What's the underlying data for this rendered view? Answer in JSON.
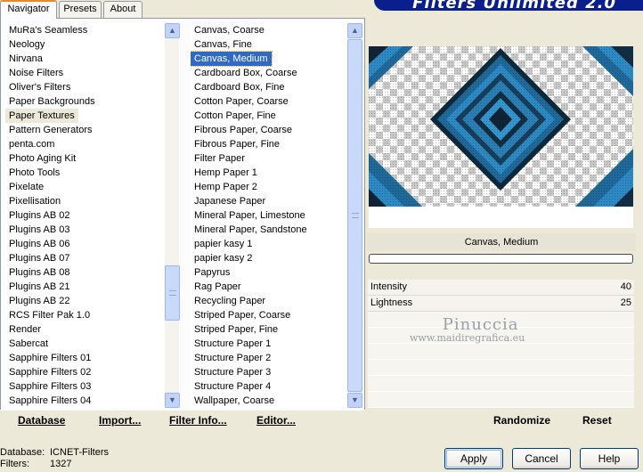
{
  "tabs": [
    "Navigator",
    "Presets",
    "About"
  ],
  "banner_title": "Filters Unlimited 2.0",
  "categories": [
    "MuRa's Seamless",
    "Neology",
    "Nirvana",
    "Noise Filters",
    "Oliver's Filters",
    "Paper Backgrounds",
    "Paper Textures",
    "Pattern Generators",
    "penta.com",
    "Photo Aging Kit",
    "Photo Tools",
    "Pixelate",
    "Pixellisation",
    "Plugins AB 02",
    "Plugins AB 03",
    "Plugins AB 06",
    "Plugins AB 07",
    "Plugins AB 08",
    "Plugins AB 21",
    "Plugins AB 22",
    "RCS Filter Pak 1.0",
    "Render",
    "Sabercat",
    "Sapphire Filters 01",
    "Sapphire Filters 02",
    "Sapphire Filters 03",
    "Sapphire Filters 04"
  ],
  "selected_category": "Paper Textures",
  "filters": [
    "Canvas, Coarse",
    "Canvas, Fine",
    "Canvas, Medium",
    "Cardboard Box, Coarse",
    "Cardboard Box, Fine",
    "Cotton Paper, Coarse",
    "Cotton Paper, Fine",
    "Fibrous Paper, Coarse",
    "Fibrous Paper, Fine",
    "Filter Paper",
    "Hemp Paper 1",
    "Hemp Paper 2",
    "Japanese Paper",
    "Mineral Paper, Limestone",
    "Mineral Paper, Sandstone",
    "papier kasy 1",
    "papier kasy 2",
    "Papyrus",
    "Rag Paper",
    "Recycling Paper",
    "Striped Paper, Coarse",
    "Striped Paper, Fine",
    "Structure Paper 1",
    "Structure Paper 2",
    "Structure Paper 3",
    "Structure Paper 4",
    "Wallpaper, Coarse"
  ],
  "selected_filter": "Canvas, Medium",
  "left_buttons": {
    "database": "Database",
    "import": "Import...",
    "filter_info": "Filter Info...",
    "editor": "Editor..."
  },
  "current_filter_name": "Canvas, Medium",
  "parameters": [
    {
      "label": "Intensity",
      "value": "40"
    },
    {
      "label": "Lightness",
      "value": "25"
    }
  ],
  "watermark": {
    "title": "Pinuccia",
    "url": "www.maidiregrafica.eu"
  },
  "right_buttons": {
    "randomize": "Randomize",
    "reset": "Reset"
  },
  "status": {
    "database_label": "Database:",
    "database_value": "ICNET-Filters",
    "filters_label": "Filters:",
    "filters_value": "1327"
  },
  "dialog_buttons": {
    "apply": "Apply",
    "cancel": "Cancel",
    "help": "Help"
  },
  "colors": {
    "selection": "#316ac5",
    "preview_blue": "#2a7fb5",
    "banner": "#0a1e8c"
  }
}
